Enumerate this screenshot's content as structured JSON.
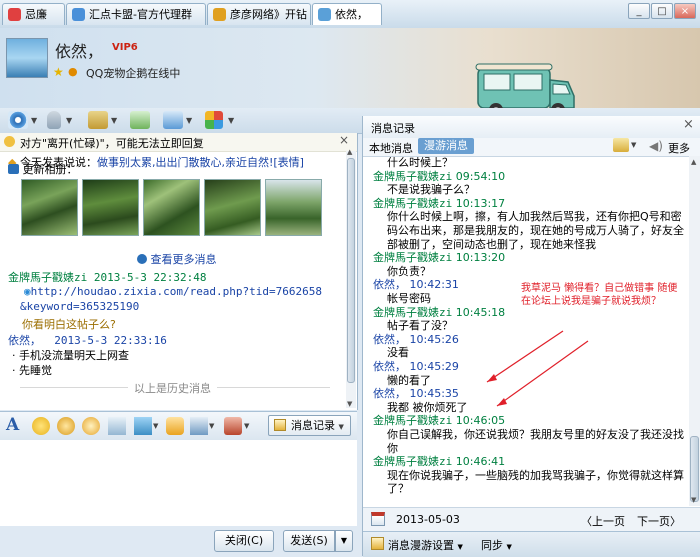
{
  "tabs": [
    {
      "label": "忌廉",
      "color": "#e04040"
    },
    {
      "label": "汇点卡盟-官方代理群",
      "color": "#4a90d9"
    },
    {
      "label": "彦彦网络》开钻",
      "color": "#e0a020"
    },
    {
      "label": "依然，",
      "color": "#5aa0d8"
    }
  ],
  "window_buttons": {
    "minimize": "_",
    "maximize": "□",
    "close": "×"
  },
  "header": {
    "nickname": "依然，",
    "vip": "VIP6",
    "status": "QQ宠物企鹅在线中"
  },
  "left": {
    "away_notice": "对方\"离开(忙碌)\"，可能无法立即回复",
    "say_prefix": "今天发表说说：",
    "say_text": "做事别太累,出出门散散心,亲近自然!",
    "say_tag": "[表情]",
    "album_title": "更新相册：",
    "view_more": "查看更多消息",
    "msgs": [
      {
        "name": "金牌馬子戳婊zi",
        "time": "2013-5-3 22:32:48",
        "link1": "http://houdao.zixia.com/read.php?tid=7662658",
        "link2": "&keyword=365325190",
        "text": "你看明白这帖子么?"
      },
      {
        "name": "依然，",
        "time": "2013-5-3 22:33:16",
        "lines": [
          "手机没流量明天上网查",
          "先睡觉"
        ]
      }
    ],
    "history_marker": "以上是历史消息"
  },
  "input_toolbar": {
    "history_button": "消息记录"
  },
  "bottom_buttons": {
    "close": "关闭(C)",
    "send": "发送(S)"
  },
  "right": {
    "title": "消息记录",
    "tab_local": "本地消息",
    "tab_roam": "漫游消息",
    "more": "更多",
    "partial_top": "什么时候上？",
    "messages": [
      {
        "sender": "金牌馬子戳婊zi",
        "time": "09:54:10",
        "lines": [
          "不是说我骗子么？"
        ],
        "type": "other"
      },
      {
        "sender": "金牌馬子戳婊zi",
        "time": "10:13:17",
        "lines": [
          "你什么时候上啊，擦，有人加我然后骂我，还有你把Q号和密",
          "码公布出来，那是我朋友的，现在她的号成万人骑了，好友全",
          "部被删了，空间动态也删了，现在她来怪我"
        ],
        "type": "other"
      },
      {
        "sender": "金牌馬子戳婊zi",
        "time": "10:13:20",
        "lines": [
          "你负责？"
        ],
        "type": "other"
      },
      {
        "sender": "依然，",
        "time": "10:42:31",
        "lines": [
          "帐号密码"
        ],
        "type": "self"
      },
      {
        "sender": "金牌馬子戳婊zi",
        "time": "10:45:18",
        "lines": [
          "帖子看了没？"
        ],
        "type": "other"
      },
      {
        "sender": "依然，",
        "time": "10:45:26",
        "lines": [
          "没看"
        ],
        "type": "self"
      },
      {
        "sender": "依然，",
        "time": "10:45:29",
        "lines": [
          "懒的看了"
        ],
        "type": "self"
      },
      {
        "sender": "依然，",
        "time": "10:45:35",
        "lines": [
          "我都 被你烦死了"
        ],
        "type": "self"
      },
      {
        "sender": "金牌馬子戳婊zi",
        "time": "10:46:05",
        "lines": [
          "你自己误解我，你还说我烦？我朋友号里的好友没了我还没找",
          "你"
        ],
        "type": "other"
      },
      {
        "sender": "金牌馬子戳婊zi",
        "time": "10:46:41",
        "lines": [
          "现在你说我骗子，一些脑残的加我骂我骗子，你觉得就这样算",
          "了？"
        ],
        "type": "other"
      }
    ],
    "annotation": [
      "我草泥马 懒得看？自己做错事 随便",
      "在论坛上说我是骗子就说我烦？"
    ],
    "date": "2013-05-03",
    "prev": "上一页",
    "next": "下一页",
    "footer_settings": "消息漫游设置",
    "footer_sync": "同步"
  },
  "colors": {
    "other_name": "#008040",
    "self_name": "#1a44a6",
    "annotation": "#e0202a"
  }
}
